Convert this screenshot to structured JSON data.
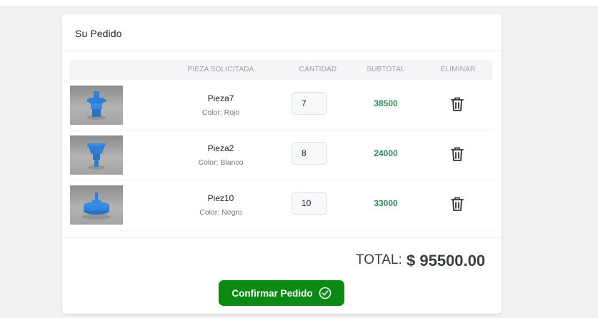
{
  "order": {
    "title": "Su Pedido",
    "columns": {
      "piece": "PIEZA SOLICITADA",
      "quantity": "CANTIDAD",
      "subtotal": "SUBTOTAL",
      "remove": "ELIMINAR"
    },
    "items": [
      {
        "name": "Pieza7",
        "color": "Color: Rojo",
        "quantity": "7",
        "subtotal": "38500",
        "thumbnail_icon": "blue-gear-part-image"
      },
      {
        "name": "Pieza2",
        "color": "Color: Blanco",
        "quantity": "8",
        "subtotal": "24000",
        "thumbnail_icon": "blue-funnel-part-image"
      },
      {
        "name": "Piez10",
        "color": "Color: Negro",
        "quantity": "10",
        "subtotal": "33000",
        "thumbnail_icon": "blue-knob-part-image"
      }
    ],
    "total_label": "TOTAL:",
    "total_value": "$ 95500.00",
    "confirm_label": "Confirmar Pedido"
  },
  "colors": {
    "page_bg": "#f0f1f3",
    "card_bg": "#ffffff",
    "subtotal_green": "#2e8b57",
    "confirm_button": "#0a8a12",
    "part_blue": "#2f7fd6"
  },
  "icons": {
    "remove": "trash-icon",
    "confirm": "check-circle-icon"
  }
}
